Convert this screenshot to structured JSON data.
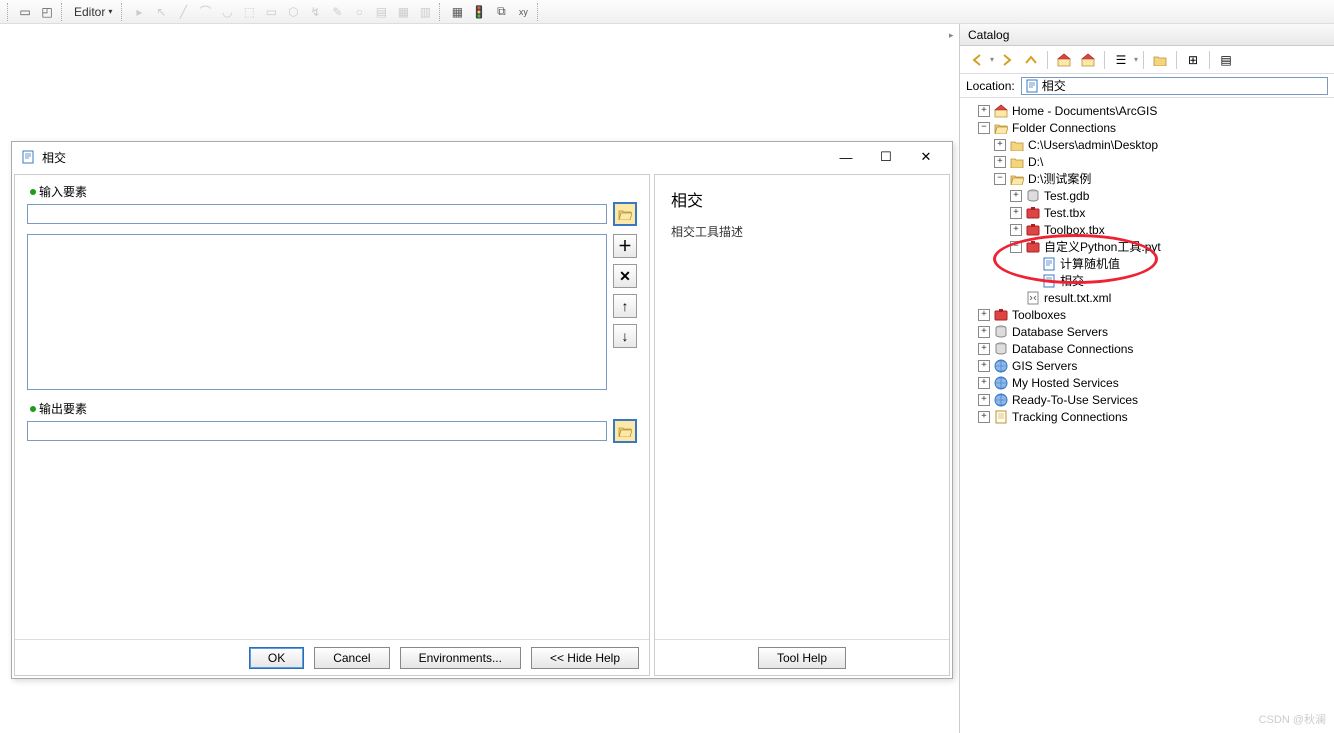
{
  "toolbar": {
    "editor_label": "Editor"
  },
  "dialog": {
    "title": "相交",
    "input_label": "输入要素",
    "output_label": "输出要素",
    "buttons": {
      "ok": "OK",
      "cancel": "Cancel",
      "environments": "Environments...",
      "hide_help": "<< Hide Help",
      "tool_help": "Tool Help"
    }
  },
  "help": {
    "title": "相交",
    "description": "相交工具描述"
  },
  "catalog": {
    "title": "Catalog",
    "location_label": "Location:",
    "location_value": "相交",
    "tree": {
      "home": "Home - Documents\\ArcGIS",
      "folder_connections": "Folder Connections",
      "desktop": "C:\\Users\\admin\\Desktop",
      "d_drive": "D:\\",
      "test_case": "D:\\测试案例",
      "test_gdb": "Test.gdb",
      "test_tbx": "Test.tbx",
      "toolbox_tbx": "Toolbox.tbx",
      "python_tool": "自定义Python工具.pyt",
      "calc_random": "计算随机值",
      "intersect": "相交",
      "result_xml": "result.txt.xml",
      "toolboxes": "Toolboxes",
      "db_servers": "Database Servers",
      "db_connections": "Database Connections",
      "gis_servers": "GIS Servers",
      "hosted": "My Hosted Services",
      "ready": "Ready-To-Use Services",
      "tracking": "Tracking Connections"
    }
  },
  "watermark": "CSDN @秋澜"
}
